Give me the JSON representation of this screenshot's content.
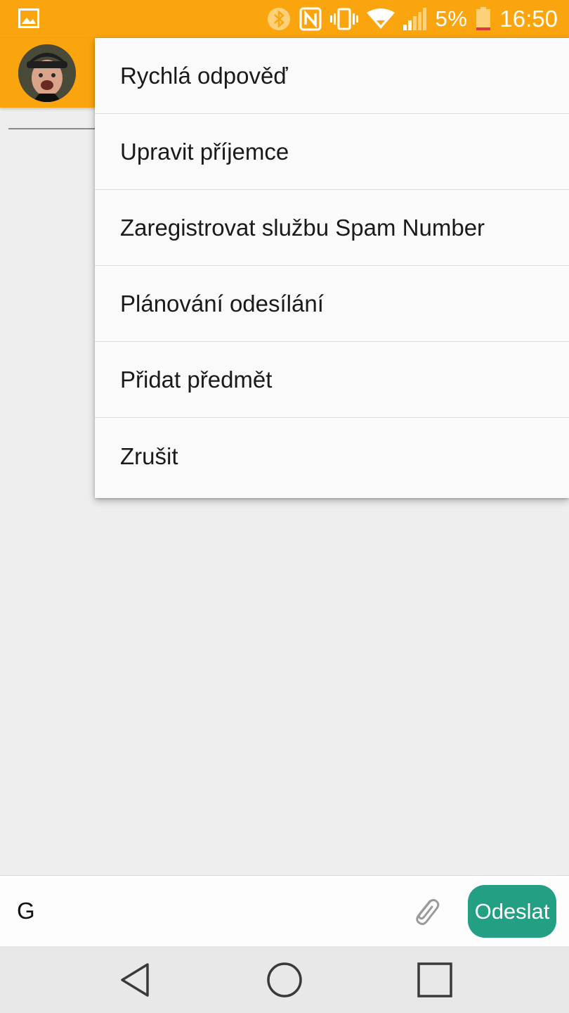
{
  "status_bar": {
    "battery_text": "5%",
    "time": "16:50",
    "icons": [
      "gallery-icon",
      "bluetooth-icon",
      "nfc-icon",
      "vibrate-icon",
      "wifi-icon",
      "signal-icon",
      "battery-icon"
    ]
  },
  "toolbar": {
    "avatar": "contact-avatar"
  },
  "menu": {
    "items": [
      {
        "label": "Rychlá odpověď"
      },
      {
        "label": "Upravit příjemce"
      },
      {
        "label": "Zaregistrovat službu Spam Number"
      },
      {
        "label": "Plánování odesílání"
      },
      {
        "label": "Přidat předmět"
      },
      {
        "label": "Zrušit"
      }
    ]
  },
  "compose": {
    "input_value": "G",
    "send_label": "Odeslat"
  },
  "colors": {
    "accent": "#fba50e",
    "send": "#23a083"
  }
}
